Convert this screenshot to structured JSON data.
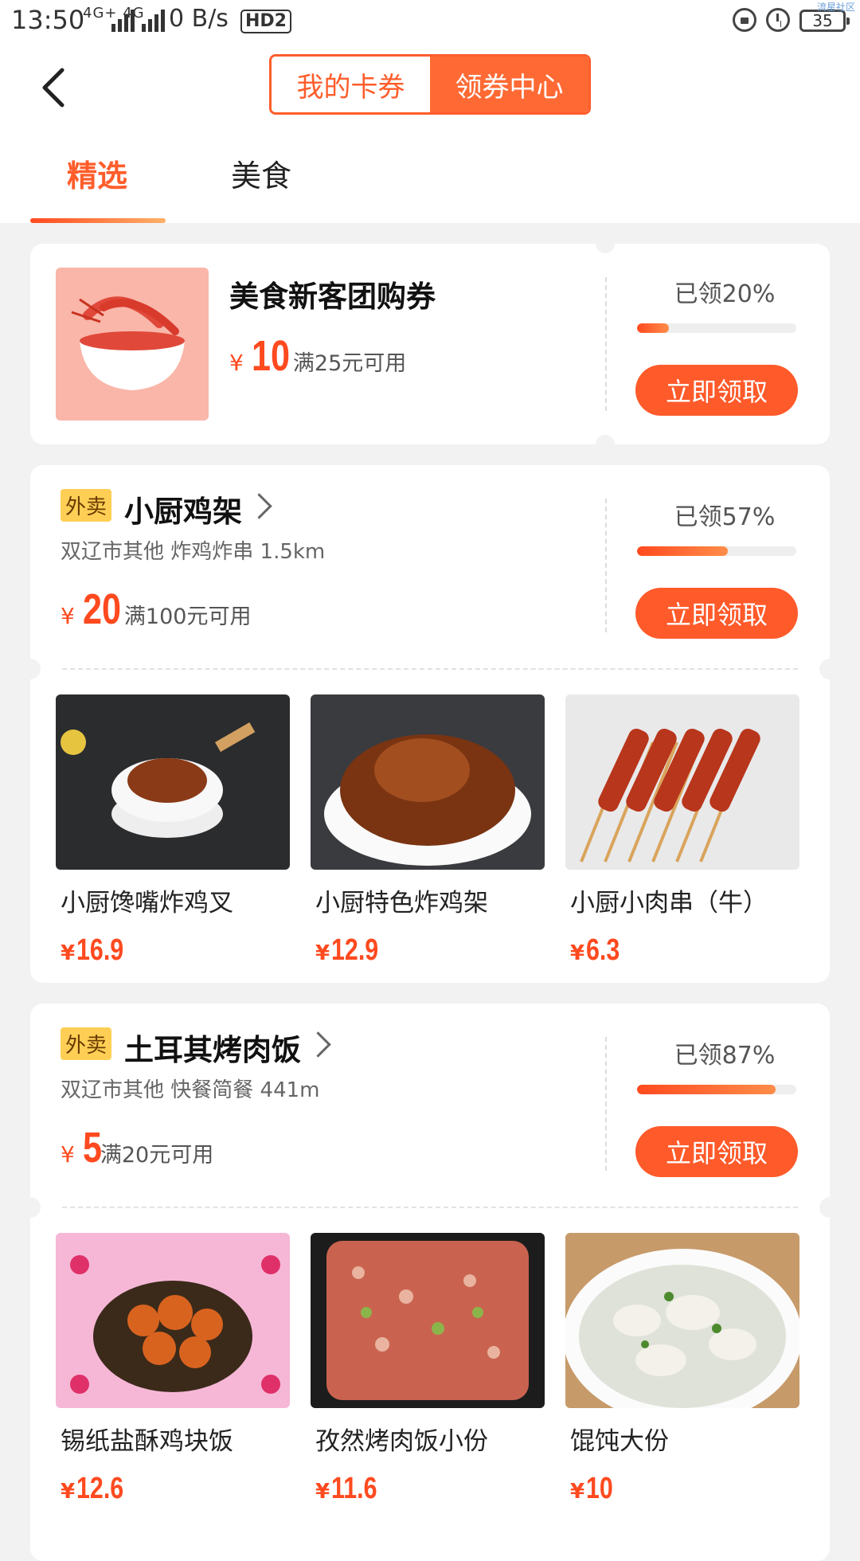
{
  "status_bar": {
    "time": "13:50",
    "signal": "4G+ 4G",
    "net_speed": "0 B/s",
    "hd": "HD2",
    "battery": "35",
    "watermark": "流星社区"
  },
  "header": {
    "segment": [
      "我的卡券",
      "领券中心"
    ],
    "tabs": [
      "精选",
      "美食"
    ]
  },
  "colors": {
    "accent": "#ff5a2a",
    "tag_bg": "#ffcf55"
  },
  "coupons": [
    {
      "title": "美食新客团购券",
      "price_symbol": "¥",
      "amount": "10",
      "condition": "满25元可用",
      "claimed_text": "已领20%",
      "claimed_fraction": 0.2,
      "button": "立即领取"
    },
    {
      "tag": "外卖",
      "title": "小厨鸡架",
      "subtitle": "双辽市其他 炸鸡炸串 1.5km",
      "price_symbol": "¥",
      "amount": "20",
      "condition": "满100元可用",
      "claimed_text": "已领57%",
      "claimed_fraction": 0.57,
      "button": "立即领取",
      "products": [
        {
          "name": "小厨馋嘴炸鸡叉",
          "symbol": "¥",
          "price": "16.9"
        },
        {
          "name": "小厨特色炸鸡架",
          "symbol": "¥",
          "price": "12.9"
        },
        {
          "name": "小厨小肉串（牛）",
          "symbol": "¥",
          "price": "6.3"
        }
      ]
    },
    {
      "tag": "外卖",
      "title": "土耳其烤肉饭",
      "subtitle": "双辽市其他 快餐简餐 441m",
      "price_symbol": "¥",
      "amount": "5",
      "condition": "满20元可用",
      "claimed_text": "已领87%",
      "claimed_fraction": 0.87,
      "button": "立即领取",
      "products": [
        {
          "name": "锡纸盐酥鸡块饭",
          "symbol": "¥",
          "price": "12.6"
        },
        {
          "name": "孜然烤肉饭小份",
          "symbol": "¥",
          "price": "11.6"
        },
        {
          "name": "馄饨大份",
          "symbol": "¥",
          "price": "10"
        }
      ]
    }
  ]
}
